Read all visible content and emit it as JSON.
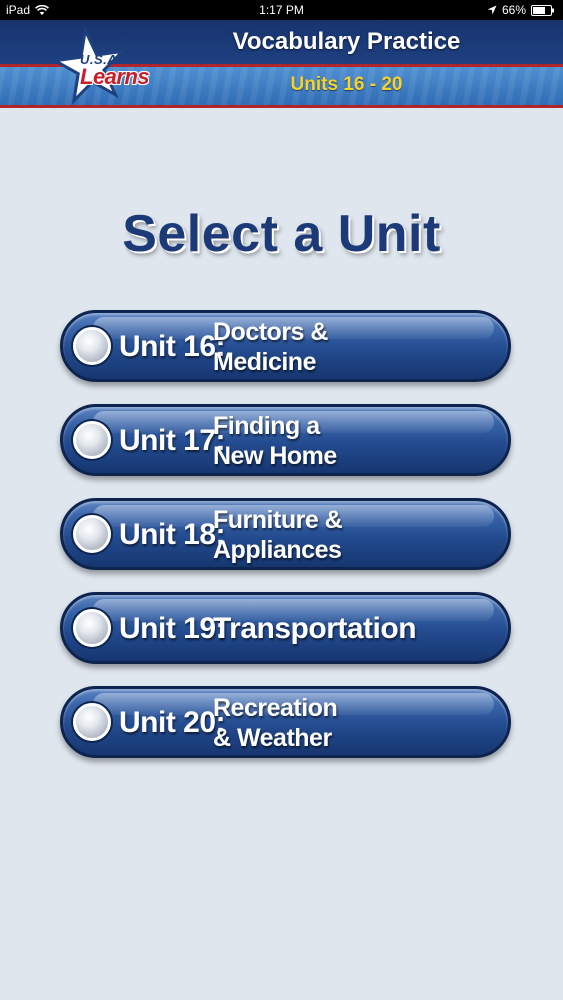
{
  "status_bar": {
    "device": "iPad",
    "time": "1:17 PM",
    "battery": "66%"
  },
  "header": {
    "logo_top": "U.S.A.",
    "logo_main": "Learns",
    "title": "Vocabulary Practice",
    "subtitle": "Units 16 - 20"
  },
  "main": {
    "title": "Select a Unit",
    "units": [
      {
        "label": "Unit 16:",
        "name_line1": "Doctors &",
        "name_line2": "Medicine"
      },
      {
        "label": "Unit 17:",
        "name_line1": "Finding a",
        "name_line2": "New Home"
      },
      {
        "label": "Unit 18:",
        "name_line1": "Furniture &",
        "name_line2": "Appliances"
      },
      {
        "label": "Unit 19:",
        "name_line1": "Transportation",
        "name_line2": ""
      },
      {
        "label": "Unit 20:",
        "name_line1": "Recreation",
        "name_line2": "& Weather"
      }
    ]
  },
  "colors": {
    "header_blue": "#17346e",
    "band_blue": "#2f6cb4",
    "accent_red": "#b0242c",
    "subtitle_yellow": "#f7d22a",
    "title_navy": "#1d3a78",
    "background": "#dfe6ee"
  }
}
